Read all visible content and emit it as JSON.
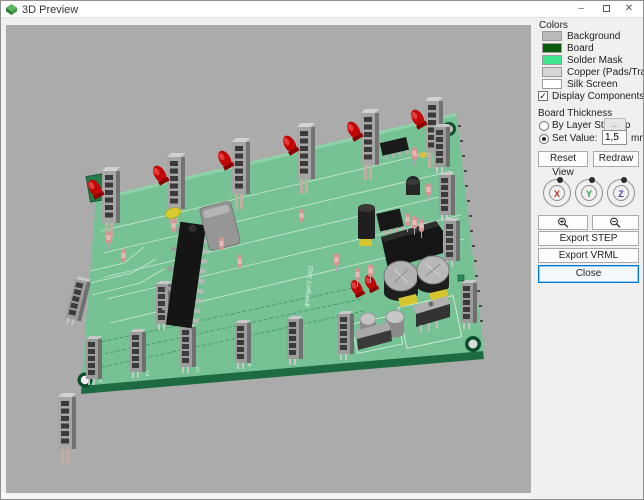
{
  "window": {
    "title": "3D Preview",
    "minimize_glyph": "–",
    "close_glyph": "✕"
  },
  "panel": {
    "colors": {
      "heading": "Colors",
      "items": [
        {
          "label": "Background",
          "color": "#b9b9b9"
        },
        {
          "label": "Board",
          "color": "#0b5d0b"
        },
        {
          "label": "Solder Mask",
          "color": "#3fe68f"
        },
        {
          "label": "Copper (Pads/Traces)",
          "color": "#d6d6d6"
        },
        {
          "label": "Silk Screen",
          "color": "#ffffff"
        }
      ]
    },
    "display_components_label": "Display Components",
    "board_thickness": {
      "heading": "Board Thickness",
      "by_layer_label": "By Layer Stackup",
      "stackup_button_label": "...",
      "set_value_label": "Set Value:",
      "value": "1,5",
      "unit": "mm"
    },
    "reset_view_label": "Reset View",
    "redraw_label": "Redraw",
    "dials": [
      {
        "letter": "X",
        "color": "#b4342c"
      },
      {
        "letter": "Y",
        "color": "#2f9e4f"
      },
      {
        "letter": "Z",
        "color": "#4b3fae"
      }
    ],
    "export_step_label": "Export STEP",
    "export_vrml_label": "Export VRML",
    "close_label": "Close"
  },
  "viewport": {
    "silkscreen_text": "grainger'2 2022",
    "connector_labels": [
      "1",
      "2",
      "3",
      "4"
    ],
    "colors": {
      "canvas": "#ababab",
      "board_top": "#76c295",
      "board_edge": "#1d6b41"
    }
  }
}
